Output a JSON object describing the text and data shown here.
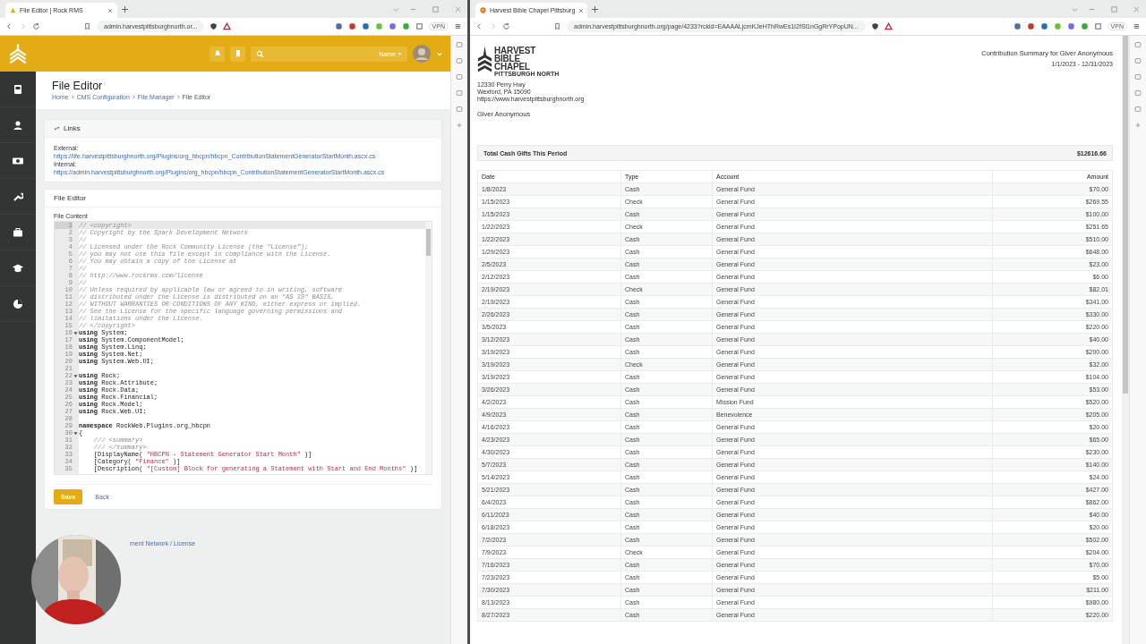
{
  "left_browser": {
    "tab": {
      "title": "File Editor | Rock RMS",
      "kind": "rock"
    },
    "url": "admin.harvestpittsburghnorth.or...",
    "vpn": "VPN"
  },
  "rock": {
    "header": {
      "name_menu": "Name"
    },
    "page_title": "File Editor",
    "breadcrumbs": [
      "Home",
      "CMS Configuration",
      "File Manager",
      "File Editor"
    ],
    "links_panel": {
      "title": "Links",
      "external_label": "External:",
      "external_url": "https://life.harvestpittsburghnorth.org/Plugins/org_hbcpn/hbcpn_ContributionStatementGeneratorStartMonth.ascx.cs",
      "internal_label": "Internal:",
      "internal_url": "https://admin.harvestpittsburghnorth.org/Plugins/org_hbcpn/hbcpn_ContributionStatementGeneratorStartMonth.ascx.cs"
    },
    "editor_panel": {
      "title": "File Editor",
      "field_label": "File Content",
      "lines": [
        {
          "number": "1",
          "kind": "comment",
          "text": "// <copyright>",
          "active": true
        },
        {
          "number": "2",
          "kind": "comment",
          "text": "// Copyright by the Spark Development Network",
          "active": false
        },
        {
          "number": "3",
          "kind": "comment",
          "text": "//",
          "active": false
        },
        {
          "number": "4",
          "kind": "comment",
          "text": "// Licensed under the Rock Community License (the \"License\");",
          "active": false
        },
        {
          "number": "5",
          "kind": "comment",
          "text": "// you may not use this file except in compliance with the License.",
          "active": false
        },
        {
          "number": "6",
          "kind": "comment",
          "text": "// You may obtain a copy of the License at",
          "active": false
        },
        {
          "number": "7",
          "kind": "comment",
          "text": "//",
          "active": false
        },
        {
          "number": "8",
          "kind": "comment",
          "text": "// http://www.rockrms.com/license",
          "active": false
        },
        {
          "number": "9",
          "kind": "comment",
          "text": "//",
          "active": false
        },
        {
          "number": "10",
          "kind": "comment",
          "text": "// Unless required by applicable law or agreed to in writing, software",
          "active": false
        },
        {
          "number": "11",
          "kind": "comment",
          "text": "// distributed under the License is distributed on an \"AS IS\" BASIS,",
          "active": false
        },
        {
          "number": "12",
          "kind": "comment",
          "text": "// WITHOUT WARRANTIES OR CONDITIONS OF ANY KIND, either express or implied.",
          "active": false
        },
        {
          "number": "13",
          "kind": "comment",
          "text": "// See the License for the specific language governing permissions and",
          "active": false
        },
        {
          "number": "14",
          "kind": "comment",
          "text": "// limitations under the License.",
          "active": false
        },
        {
          "number": "15",
          "kind": "comment",
          "text": "// </copyright>",
          "active": false
        },
        {
          "number": "16",
          "kind": "code",
          "text": "**using** System;",
          "fold": true,
          "active": false
        },
        {
          "number": "17",
          "kind": "code",
          "text": "**using** System.ComponentModel;",
          "active": false
        },
        {
          "number": "18",
          "kind": "code",
          "text": "**using** System.Linq;",
          "active": false
        },
        {
          "number": "19",
          "kind": "code",
          "text": "**using** System.Net;",
          "active": false
        },
        {
          "number": "20",
          "kind": "code",
          "text": "**using** System.Web.UI;",
          "active": false
        },
        {
          "number": "21",
          "kind": "blank",
          "active": false
        },
        {
          "number": "22",
          "kind": "code",
          "text": "**using** Rock;",
          "fold": true,
          "active": false
        },
        {
          "number": "23",
          "kind": "code",
          "text": "**using** Rock.Attribute;",
          "active": false
        },
        {
          "number": "24",
          "kind": "code",
          "text": "**using** Rock.Data;",
          "active": false
        },
        {
          "number": "25",
          "kind": "code",
          "text": "**using** Rock.Financial;",
          "active": false
        },
        {
          "number": "26",
          "kind": "code",
          "text": "**using** Rock.Model;",
          "active": false
        },
        {
          "number": "27",
          "kind": "code",
          "text": "**using** Rock.Web.UI;",
          "active": false
        },
        {
          "number": "28",
          "kind": "blank",
          "active": false
        },
        {
          "number": "29",
          "kind": "code",
          "text": "**namespace** RockWeb.Plugins.org_hbcpn",
          "active": false
        },
        {
          "number": "30",
          "kind": "code",
          "text": "{",
          "fold": true,
          "active": false
        },
        {
          "number": "31",
          "kind": "comment",
          "text": "    /// <summary>",
          "active": false
        },
        {
          "number": "32",
          "kind": "comment",
          "text": "    /// </summary>",
          "active": false
        },
        {
          "number": "33",
          "kind": "attribute",
          "before": "    [DisplayName( ",
          "string": "\"HBCPN - Statement Generator Start Month\"",
          "after": " )]",
          "active": false
        },
        {
          "number": "34",
          "kind": "attribute",
          "before": "    [Category( ",
          "string": "\"Finance\"",
          "after": " )]",
          "active": false
        },
        {
          "number": "35",
          "kind": "attribute",
          "before": "    [Description( ",
          "string": "\"[Custom] Block for generating a Statement with Start and End Months\"",
          "after": " )]",
          "active": false
        }
      ]
    },
    "buttons": {
      "save": "Save",
      "back": "Back"
    },
    "footer": {
      "text": "ment Network / ",
      "link": "License"
    }
  },
  "right_browser": {
    "tab": {
      "title": "Harvest Bible Chapel Pittsburg",
      "kind": "church"
    },
    "url": "admin.harvestpittsburghnorth.org/page/4233?rckid=EAAAALjcmKJeHThRwEs1I2fSl1nGgRrYPopUN...",
    "vpn": "VPN"
  },
  "statement": {
    "logo_lines": [
      "HARVEST",
      "BIBLE",
      "CHAPEL"
    ],
    "logo_subline": "PITTSBURGH NORTH",
    "address": [
      "12330 Perry Hwy",
      "Wexford, PA 15090",
      "https://www.harvestpittsburghnorth.org"
    ],
    "giver": "Giver Anonymous",
    "title": "Contribution Summary for Giver Anonymous",
    "date_range": "1/1/2023 - 12/31/2023",
    "total_label": "Total Cash Gifts This Period",
    "total_amount": "$12616.66",
    "columns": [
      "Date",
      "Type",
      "Account",
      "Amount"
    ],
    "rows": [
      [
        "1/8/2023",
        "Cash",
        "General Fund",
        "$70.00"
      ],
      [
        "1/15/2023",
        "Check",
        "General Fund",
        "$269.55"
      ],
      [
        "1/15/2023",
        "Cash",
        "General Fund",
        "$100.00"
      ],
      [
        "1/22/2023",
        "Check",
        "General Fund",
        "$251.65"
      ],
      [
        "1/22/2023",
        "Cash",
        "General Fund",
        "$510.00"
      ],
      [
        "1/29/2023",
        "Cash",
        "General Fund",
        "$648.00"
      ],
      [
        "2/5/2023",
        "Cash",
        "General Fund",
        "$23.00"
      ],
      [
        "2/12/2023",
        "Cash",
        "General Fund",
        "$6.00"
      ],
      [
        "2/19/2023",
        "Check",
        "General Fund",
        "$82.01"
      ],
      [
        "2/19/2023",
        "Cash",
        "General Fund",
        "$341.00"
      ],
      [
        "2/26/2023",
        "Cash",
        "General Fund",
        "$330.00"
      ],
      [
        "3/5/2023",
        "Cash",
        "General Fund",
        "$220.00"
      ],
      [
        "3/12/2023",
        "Cash",
        "General Fund",
        "$40.00"
      ],
      [
        "3/19/2023",
        "Cash",
        "General Fund",
        "$200.00"
      ],
      [
        "3/19/2023",
        "Check",
        "General Fund",
        "$32.00"
      ],
      [
        "3/19/2023",
        "Cash",
        "General Fund",
        "$104.00"
      ],
      [
        "3/26/2023",
        "Cash",
        "General Fund",
        "$53.00"
      ],
      [
        "4/2/2023",
        "Cash",
        "Mission Fund",
        "$520.00"
      ],
      [
        "4/9/2023",
        "Cash",
        "Benevolence",
        "$205.00"
      ],
      [
        "4/16/2023",
        "Cash",
        "General Fund",
        "$20.00"
      ],
      [
        "4/23/2023",
        "Cash",
        "General Fund",
        "$65.00"
      ],
      [
        "4/30/2023",
        "Cash",
        "General Fund",
        "$230.00"
      ],
      [
        "5/7/2023",
        "Cash",
        "General Fund",
        "$140.00"
      ],
      [
        "5/14/2023",
        "Cash",
        "General Fund",
        "$24.00"
      ],
      [
        "5/21/2023",
        "Cash",
        "General Fund",
        "$427.00"
      ],
      [
        "6/4/2023",
        "Cash",
        "General Fund",
        "$862.00"
      ],
      [
        "6/11/2023",
        "Cash",
        "General Fund",
        "$40.00"
      ],
      [
        "6/18/2023",
        "Cash",
        "General Fund",
        "$20.00"
      ],
      [
        "7/2/2023",
        "Cash",
        "General Fund",
        "$502.00"
      ],
      [
        "7/9/2023",
        "Check",
        "General Fund",
        "$204.00"
      ],
      [
        "7/16/2023",
        "Cash",
        "General Fund",
        "$70.00"
      ],
      [
        "7/23/2023",
        "Cash",
        "General Fund",
        "$5.00"
      ],
      [
        "7/30/2023",
        "Cash",
        "General Fund",
        "$211.00"
      ],
      [
        "8/13/2023",
        "Cash",
        "General Fund",
        "$980.00"
      ],
      [
        "8/27/2023",
        "Cash",
        "General Fund",
        "$220.00"
      ]
    ]
  }
}
